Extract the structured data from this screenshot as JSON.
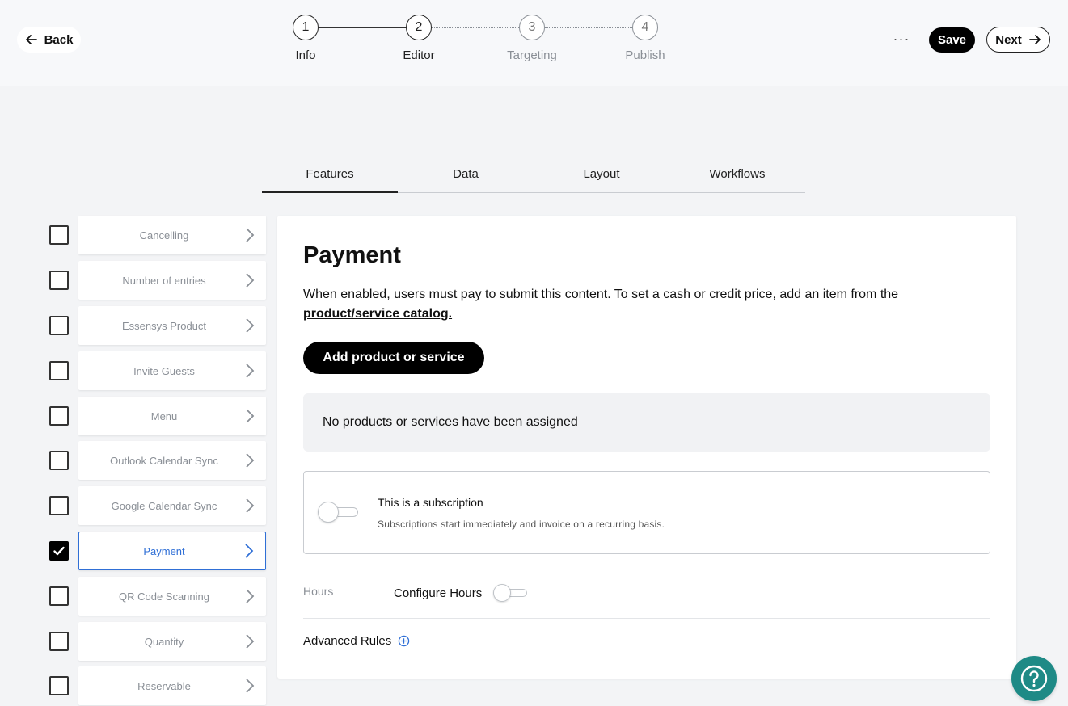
{
  "header": {
    "back_label": "Back",
    "steps": [
      {
        "number": "1",
        "label": "Info"
      },
      {
        "number": "2",
        "label": "Editor"
      },
      {
        "number": "3",
        "label": "Targeting"
      },
      {
        "number": "4",
        "label": "Publish"
      }
    ],
    "current_step": 2,
    "more_label": "···",
    "save_label": "Save",
    "next_label": "Next"
  },
  "tabs": [
    {
      "label": "Features",
      "active": true
    },
    {
      "label": "Data",
      "active": false
    },
    {
      "label": "Layout",
      "active": false
    },
    {
      "label": "Workflows",
      "active": false
    }
  ],
  "features": [
    {
      "name": "Cancelling",
      "checked": false,
      "selected": false
    },
    {
      "name": "Number of entries",
      "checked": false,
      "selected": false
    },
    {
      "name": "Essensys Product",
      "checked": false,
      "selected": false
    },
    {
      "name": "Invite Guests",
      "checked": false,
      "selected": false
    },
    {
      "name": "Menu",
      "checked": false,
      "selected": false
    },
    {
      "name": "Outlook Calendar Sync",
      "checked": false,
      "selected": false
    },
    {
      "name": "Google Calendar Sync",
      "checked": false,
      "selected": false
    },
    {
      "name": "Payment",
      "checked": true,
      "selected": true
    },
    {
      "name": "QR Code Scanning",
      "checked": false,
      "selected": false
    },
    {
      "name": "Quantity",
      "checked": false,
      "selected": false
    },
    {
      "name": "Reservable",
      "checked": false,
      "selected": false
    }
  ],
  "panel": {
    "title": "Payment",
    "description": "When enabled, users must pay to submit this content. To set a cash or credit price, add an item from the",
    "catalog_link": "product/service catalog.",
    "add_button": "Add product or service",
    "empty_message": "No products or services have been assigned",
    "subscription": {
      "title": "This is a subscription",
      "description": "Subscriptions start immediately and invoice on a recurring basis.",
      "enabled": false
    },
    "hours": {
      "label": "Hours",
      "configure_label": "Configure Hours",
      "enabled": false
    },
    "advanced_rules_label": "Advanced Rules"
  },
  "colors": {
    "accent_blue": "#2f6fd6",
    "help_button": "#1e8a86",
    "primary_button": "#000000"
  }
}
